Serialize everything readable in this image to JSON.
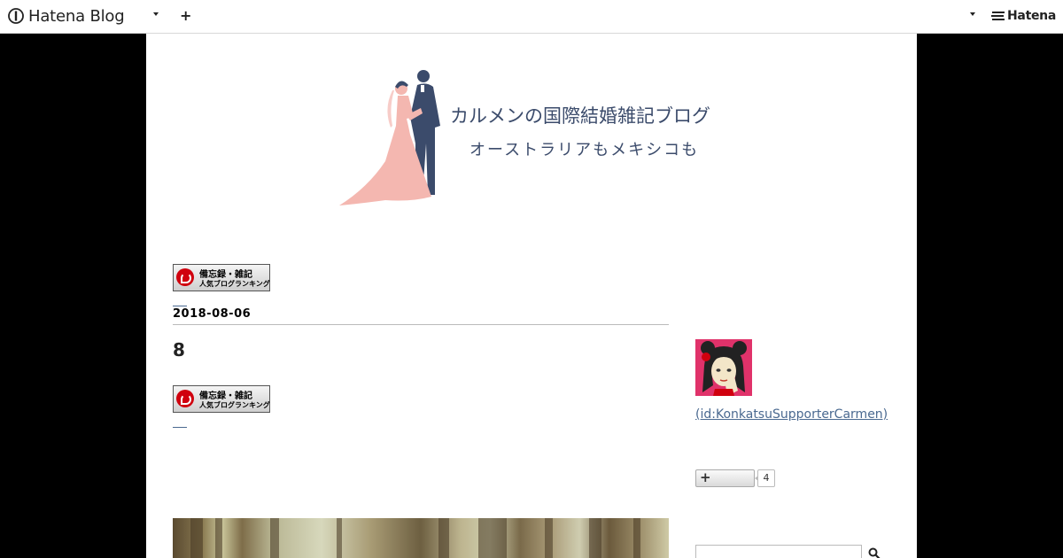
{
  "topbar": {
    "logo_text": "Hatena Blog",
    "hatena_text": "Hatena",
    "plus_label": "+"
  },
  "blog": {
    "title": "カルメンの国際結婚雑記ブログ",
    "description": "オーストラリアもメキシコも"
  },
  "ranking_banner": {
    "line1": "備忘録・雑記",
    "line2": "人気ブログランキング"
  },
  "entry": {
    "date": "2018-08-06",
    "title": "8"
  },
  "sidebar": {
    "user_id": " (id:KonkatsuSupporterCarmen)",
    "subscribe_label": "+",
    "subscriber_count": "4"
  },
  "colors": {
    "title": "#3b4b6b",
    "link": "#4a6990",
    "page_bg": "#000000"
  }
}
